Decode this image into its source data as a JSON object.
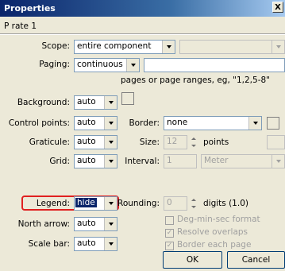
{
  "window": {
    "title": "Properties",
    "close_label": "X",
    "subtitle": "P rate 1"
  },
  "scope": {
    "label": "Scope:",
    "value": "entire component",
    "second_value": ""
  },
  "paging": {
    "label": "Paging:",
    "value": "continuous",
    "input_value": "",
    "hint": "pages or page ranges, eg, \"1,2,5-8\""
  },
  "background": {
    "label": "Background:",
    "value": "auto"
  },
  "control_points": {
    "label": "Control points:",
    "value": "auto"
  },
  "border": {
    "label": "Border:",
    "value": "none"
  },
  "graticule": {
    "label": "Graticule:",
    "value": "auto"
  },
  "size": {
    "label": "Size:",
    "value": "12",
    "unit": "points"
  },
  "grid": {
    "label": "Grid:",
    "value": "auto"
  },
  "interval": {
    "label": "Interval:",
    "value": "1",
    "unit": "Meter"
  },
  "legend": {
    "label": "Legend:",
    "value": "hide"
  },
  "rounding": {
    "label": "Rounding:",
    "value": "0",
    "unit": "digits (1.0)"
  },
  "north_arrow": {
    "label": "North arrow:",
    "value": "auto"
  },
  "scale_bar": {
    "label": "Scale bar:",
    "value": "auto"
  },
  "options": [
    {
      "label": "Deg-min-sec format",
      "checked": false,
      "mark": ""
    },
    {
      "label": "Resolve overlaps",
      "checked": true,
      "mark": "✓"
    },
    {
      "label": "Border each page",
      "checked": true,
      "mark": "✓"
    }
  ],
  "buttons": {
    "ok": "OK",
    "cancel": "Cancel"
  },
  "colors": {
    "highlight": "#e02020",
    "title_bar": "#0a246a",
    "dialog_bg": "#ece9d8"
  }
}
